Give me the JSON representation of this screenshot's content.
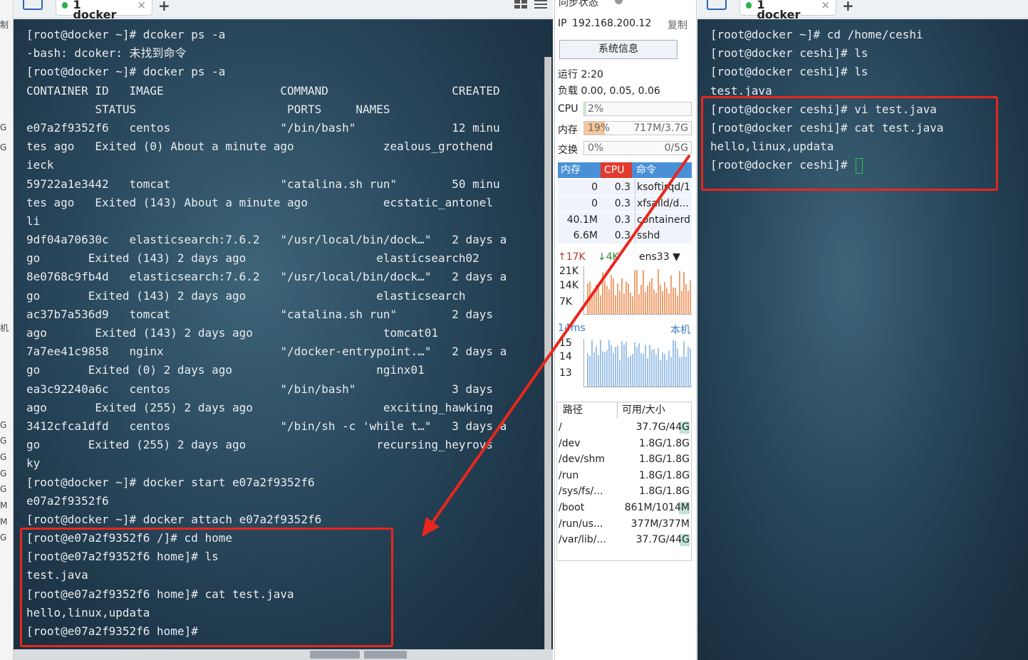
{
  "left_edge": {
    "glyphs": [
      "制",
      "G",
      "G",
      "机",
      "G",
      "G",
      "G",
      "G",
      "G",
      "M",
      "M",
      "G"
    ]
  },
  "left_pane": {
    "tab": {
      "label": "1 docker",
      "close": "×"
    },
    "add_tab": "+",
    "lines": [
      "[root@docker ~]# dcoker ps -a",
      "-bash: dcoker: 未找到命令",
      "[root@docker ~]# docker ps -a",
      "CONTAINER ID   IMAGE                 COMMAND                  CREATED",
      "          STATUS                      PORTS     NAMES",
      "e07a2f9352f6   centos                \"/bin/bash\"              12 minu",
      "tes ago   Exited (0) About a minute ago             zealous_grothend",
      "ieck",
      "59722a1e3442   tomcat                \"catalina.sh run\"        50 minu",
      "tes ago   Exited (143) About a minute ago           ecstatic_antonel",
      "li",
      "9df04a70630c   elasticsearch:7.6.2   \"/usr/local/bin/dock…\"   2 days a",
      "go       Exited (143) 2 days ago                   elasticsearch02",
      "8e0768c9fb4d   elasticsearch:7.6.2   \"/usr/local/bin/dock…\"   2 days a",
      "go       Exited (143) 2 days ago                   elasticsearch",
      "ac37b7a536d9   tomcat                \"catalina.sh run\"        2 days",
      "ago       Exited (143) 2 days ago                   tomcat01",
      "7a7ee41c9858   nginx                 \"/docker-entrypoint.…\"   2 days a",
      "go       Exited (0) 2 days ago                     nginx01",
      "ea3c92240a6c   centos                \"/bin/bash\"              3 days",
      "ago       Exited (255) 2 days ago                   exciting_hawking",
      "3412cfca1dfd   centos                \"/bin/sh -c 'while t…\"   3 days a",
      "go       Exited (255) 2 days ago                   recursing_heyrovs",
      "ky",
      "[root@docker ~]# docker start e07a2f9352f6",
      "e07a2f9352f6",
      "[root@docker ~]# docker attach e07a2f9352f6",
      "[root@e07a2f9352f6 /]# cd home",
      "[root@e07a2f9352f6 home]# ls",
      "test.java",
      "[root@e07a2f9352f6 home]# cat test.java",
      "hello,linux,updata",
      "[root@e07a2f9352f6 home]#"
    ]
  },
  "monitor": {
    "sync_status": "同步状态",
    "ip_label": "IP",
    "ip": "192.168.200.12",
    "copy": "复制",
    "sysinfo_button": "系统信息",
    "uptime": "运行 2:20",
    "load": "负载 0.00, 0.05, 0.06",
    "cpu": {
      "label": "CPU",
      "percent": "2%",
      "fraction": 0.02
    },
    "mem": {
      "label": "内存",
      "percent": "19%",
      "total": "717M/3.7G",
      "fraction": 0.19
    },
    "swap": {
      "label": "交换",
      "percent": "0%",
      "total": "0/5G",
      "fraction": 0.0
    },
    "proc_headers": [
      "内存",
      "CPU",
      "命令"
    ],
    "processes": [
      {
        "mem": "0",
        "cpu": "0.3",
        "cmd": "ksoftirqd/1"
      },
      {
        "mem": "0",
        "cpu": "0.3",
        "cmd": "xfsaild/d..."
      },
      {
        "mem": "40.1M",
        "cpu": "0.3",
        "cmd": "containerd"
      },
      {
        "mem": "6.6M",
        "cpu": "0.3",
        "cmd": "sshd"
      }
    ],
    "net": {
      "up": "17K",
      "down": "4K",
      "interface": "ens33",
      "y_labels": [
        "21K",
        "14K",
        "7K"
      ]
    },
    "latency": {
      "label": "14ms",
      "host": "本机",
      "y_labels": [
        "15",
        "14",
        "13"
      ]
    },
    "disk_headers": [
      "路径",
      "可用/大小"
    ],
    "disks": [
      {
        "path": "/",
        "size": "37.7G/44G",
        "used": 0.14
      },
      {
        "path": "/dev",
        "size": "1.8G/1.8G",
        "used": 0.0
      },
      {
        "path": "/dev/shm",
        "size": "1.8G/1.8G",
        "used": 0.0
      },
      {
        "path": "/run",
        "size": "1.8G/1.8G",
        "used": 0.01
      },
      {
        "path": "/sys/fs/...",
        "size": "1.8G/1.8G",
        "used": 0.0
      },
      {
        "path": "/boot",
        "size": "861M/1014M",
        "used": 0.15
      },
      {
        "path": "/run/us...",
        "size": "377M/377M",
        "used": 0.0
      },
      {
        "path": "/var/lib/...",
        "size": "37.7G/44G",
        "used": 0.14
      }
    ]
  },
  "right_pane": {
    "tab": {
      "label": "1 docker",
      "close": "×"
    },
    "add_tab": "+",
    "lines": [
      "[root@docker ~]# cd /home/ceshi",
      "[root@docker ceshi]# ls",
      "[root@docker ceshi]# ls",
      "test.java",
      "[root@docker ceshi]# vi test.java",
      "[root@docker ceshi]# cat test.java",
      "hello,linux,updata",
      "[root@docker ceshi]# "
    ]
  },
  "colors": {
    "highlight": "#e8271c",
    "cursor": "#31c24a",
    "terminal_text": "#e8ecee"
  }
}
